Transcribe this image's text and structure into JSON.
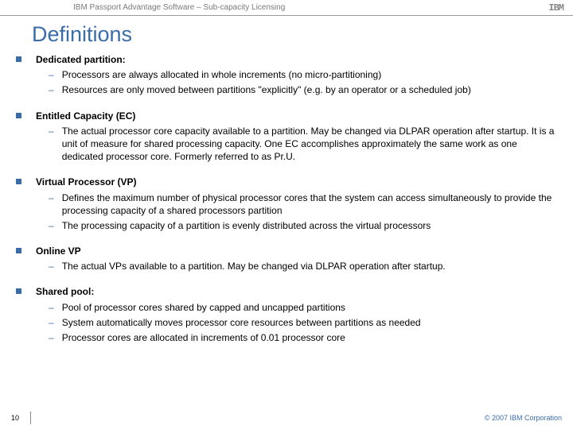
{
  "header": {
    "title": "IBM Passport Advantage Software – Sub-capacity Licensing",
    "logo": "IBM"
  },
  "slide_title": "Definitions",
  "definitions": [
    {
      "term": "Dedicated partition:",
      "items": [
        "Processors are always allocated in whole increments (no micro-partitioning)",
        "Resources are only moved between partitions \"explicitly\" (e.g. by an operator or a scheduled job)"
      ]
    },
    {
      "term": "Entitled Capacity (EC)",
      "items": [
        "The actual processor core capacity available to a partition. May be changed via DLPAR operation after startup. It is a unit of measure for shared processing capacity. One EC accomplishes approximately the same work as one dedicated processor core.  Formerly referred to as Pr.U."
      ]
    },
    {
      "term": "Virtual Processor (VP)",
      "items": [
        "Defines the maximum number of physical processor cores that the system can access simultaneously to provide the processing capacity of a shared processors partition",
        "The processing capacity of a partition is evenly distributed across the virtual processors"
      ]
    },
    {
      "term": "Online VP",
      "items": [
        "The actual VPs available to a partition. May be changed via DLPAR operation after startup."
      ]
    },
    {
      "term": "Shared pool:",
      "items": [
        "Pool of processor cores shared by capped and uncapped partitions",
        "System automatically moves processor core resources between partitions as needed",
        "Processor cores are allocated in increments of 0.01 processor core"
      ]
    }
  ],
  "footer": {
    "page": "10",
    "copyright": "© 2007 IBM Corporation"
  }
}
